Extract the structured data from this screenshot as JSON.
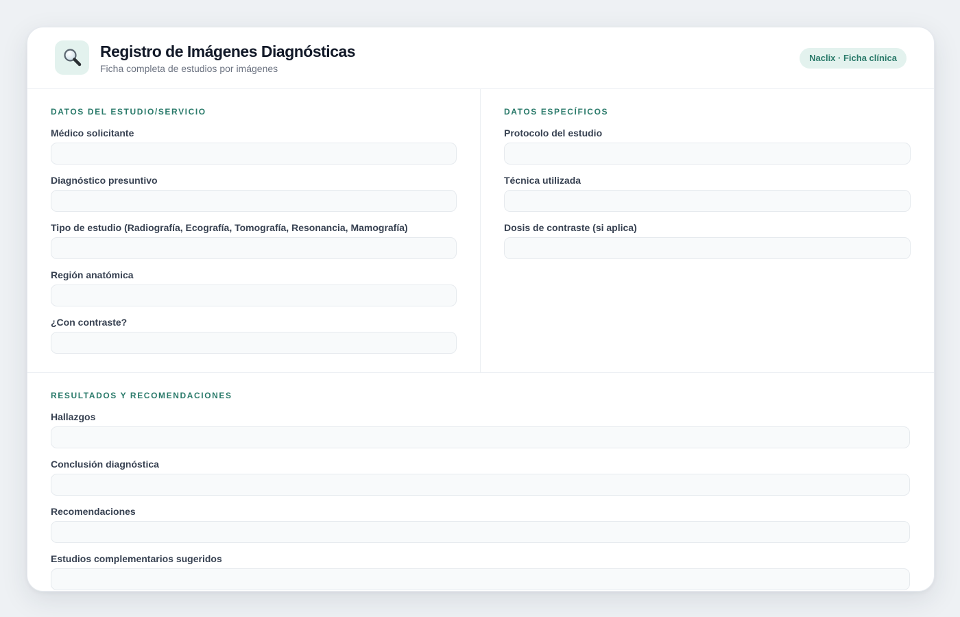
{
  "header": {
    "icon": "magnifier-icon",
    "title": "Registro de Imágenes Diagnósticas",
    "subtitle": "Ficha completa de estudios por imágenes",
    "badge": "Naclix · Ficha clínica"
  },
  "colors": {
    "accent": "#2a7a6a",
    "accent_bg": "#e3f2ee",
    "page_bg": "#eef1f4",
    "input_bg": "#f8fafb"
  },
  "sections": [
    {
      "title": "DATOS DEL ESTUDIO/SERVICIO",
      "fields": [
        {
          "label": "Médico solicitante",
          "value": ""
        },
        {
          "label": "Diagnóstico presuntivo",
          "value": ""
        },
        {
          "label": "Tipo de estudio (Radiografía, Ecografía, Tomografía, Resonancia, Mamografía)",
          "value": ""
        },
        {
          "label": "Región anatómica",
          "value": ""
        },
        {
          "label": "¿Con contraste?",
          "value": ""
        }
      ]
    },
    {
      "title": "DATOS ESPECÍFICOS",
      "fields": [
        {
          "label": "Protocolo del estudio",
          "value": ""
        },
        {
          "label": "Técnica utilizada",
          "value": ""
        },
        {
          "label": "Dosis de contraste (si aplica)",
          "value": ""
        }
      ]
    },
    {
      "title": "RESULTADOS Y RECOMENDACIONES",
      "fields": [
        {
          "label": "Hallazgos",
          "value": ""
        },
        {
          "label": "Conclusión diagnóstica",
          "value": ""
        },
        {
          "label": "Recomendaciones",
          "value": ""
        },
        {
          "label": "Estudios complementarios sugeridos",
          "value": ""
        }
      ]
    }
  ]
}
